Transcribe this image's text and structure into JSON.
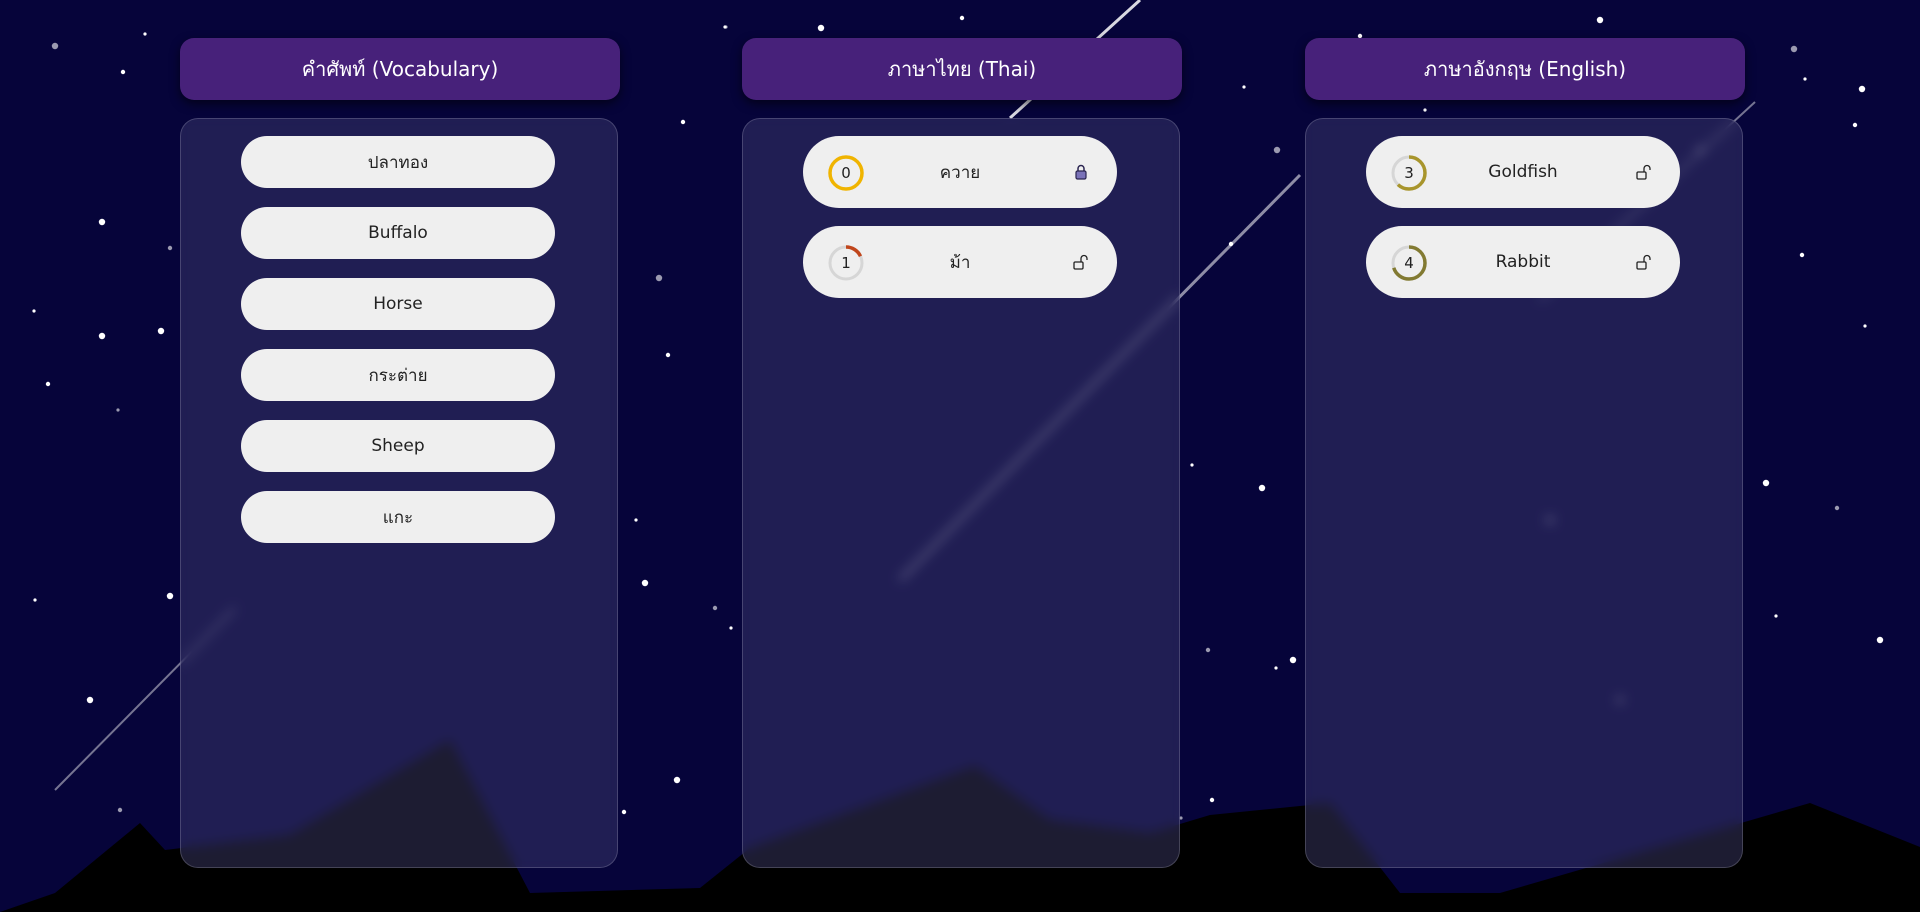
{
  "columns": {
    "vocabulary": {
      "title": "คำศัพท์ (Vocabulary)",
      "items": [
        "ปลาทอง",
        "Buffalo",
        "Horse",
        "กระต่าย",
        "Sheep",
        "แกะ"
      ]
    },
    "thai": {
      "title": "ภาษาไทย (Thai)",
      "items": [
        {
          "number": "0",
          "label": "ควาย",
          "locked": true,
          "ring_color": "#f0b400",
          "ring_fraction": 1.0
        },
        {
          "number": "1",
          "label": "ม้า",
          "locked": false,
          "ring_color": "#c0461c",
          "ring_fraction": 0.18
        }
      ]
    },
    "english": {
      "title": "ภาษาอังกฤษ (English)",
      "items": [
        {
          "number": "3",
          "label": "Goldfish",
          "locked": false,
          "ring_color": "#a8952c",
          "ring_fraction": 0.62
        },
        {
          "number": "4",
          "label": "Rabbit",
          "locked": false,
          "ring_color": "#827a32",
          "ring_fraction": 0.7
        }
      ]
    }
  },
  "colors": {
    "background": "#06043a",
    "header": "#47217a",
    "item": "#efefef"
  }
}
